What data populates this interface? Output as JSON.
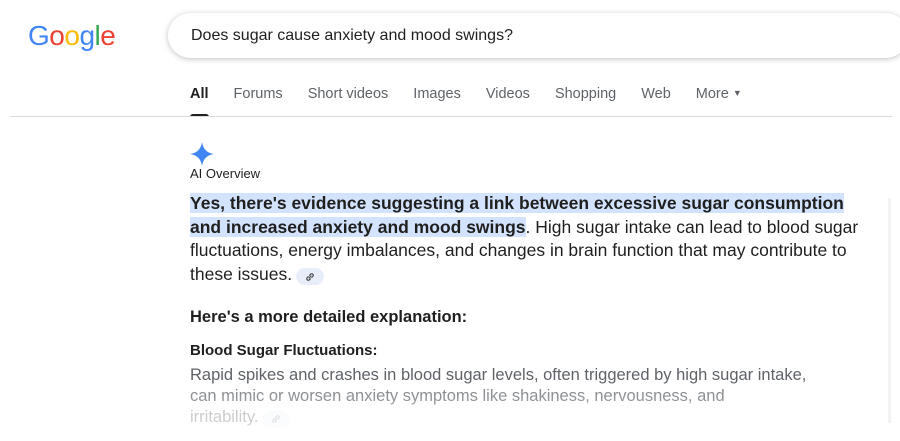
{
  "logo": {
    "letters": [
      "G",
      "o",
      "o",
      "g",
      "l",
      "e"
    ],
    "colors": [
      "#4285f4",
      "#ea4335",
      "#fbbc05",
      "#4285f4",
      "#34a853",
      "#ea4335"
    ]
  },
  "search": {
    "query": "Does sugar cause anxiety and mood swings?"
  },
  "tabs": [
    {
      "label": "All",
      "active": true
    },
    {
      "label": "Forums"
    },
    {
      "label": "Short videos"
    },
    {
      "label": "Images"
    },
    {
      "label": "Videos"
    },
    {
      "label": "Shopping"
    },
    {
      "label": "Web"
    },
    {
      "label": "More"
    }
  ],
  "ai_overview": {
    "icon": "sparkle-icon",
    "label": "AI Overview",
    "highlight": "Yes, there's evidence suggesting a link between excessive sugar consumption and increased anxiety and mood swings",
    "rest": ". High sugar intake can lead to blood sugar fluctuations, energy imbalances, and changes in brain function that may contribute to these issues.",
    "subheading": "Here's a more detailed explanation:",
    "section_title": "Blood Sugar Fluctuations:",
    "section_line1": "Rapid spikes and crashes in blood sugar levels, often triggered by high sugar intake,",
    "section_line2": "can mimic or worsen anxiety symptoms like shakiness, nervousness, and",
    "section_line3": "irritability."
  },
  "colors": {
    "highlight": "#d3e3fd",
    "sparkle": "#4285f4",
    "chip": "#e8eef9"
  }
}
